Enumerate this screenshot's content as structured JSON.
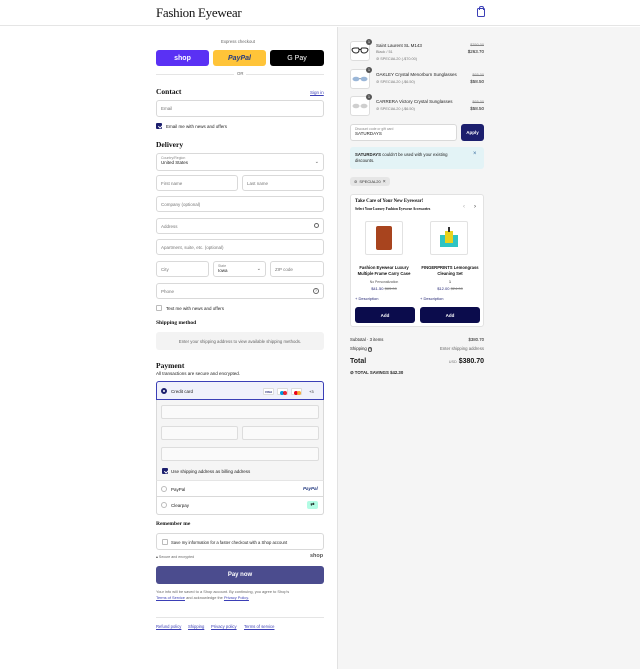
{
  "header": {
    "brand": "Fashion Eyewear",
    "cart_icon": "shopping-bag-icon"
  },
  "express": {
    "title": "Express checkout",
    "shop_label": "shop",
    "paypal_label": "PayPal",
    "gpay_label": "G Pay",
    "or_label": "OR",
    "colors": {
      "shop": "#5a31f4",
      "paypal": "#ffc439",
      "gpay": "#000000"
    }
  },
  "contact": {
    "heading": "Contact",
    "sign_in": "Sign in",
    "email_placeholder": "Email",
    "news_label": "Email me with news and offers",
    "news_checked": true
  },
  "delivery": {
    "heading": "Delivery",
    "country_label": "Country/Region",
    "country_value": "United States",
    "first_name": "First name",
    "last_name": "Last name",
    "company": "Company (optional)",
    "address": "Address",
    "apartment": "Apartment, suite, etc. (optional)",
    "city": "City",
    "state_label": "State",
    "state_value": "Iowa",
    "zip": "ZIP code",
    "phone": "Phone",
    "text_label": "Text me with news and offers"
  },
  "shipping_method": {
    "heading": "Shipping method",
    "notice": "Enter your shipping address to view available shipping methods."
  },
  "payment": {
    "heading": "Payment",
    "subtitle": "All transactions are secure and encrypted.",
    "credit_card": "Credit card",
    "card_brands": [
      "VISA",
      "",
      "",
      "+3"
    ],
    "billing_label": "Use shipping address as billing address",
    "paypal": "PayPal",
    "paypal_logo": "PayPal",
    "clearpay": "Clearpay",
    "clearpay_logo": "⇄"
  },
  "remember": {
    "heading": "Remember me",
    "save_label": "Save my information for a faster checkout with a Shop account",
    "secure": "Secure and encrypted",
    "shop_logo": "shop"
  },
  "pay_button": "Pay now",
  "legal": {
    "line1": "Your info will be saved to a Shop account. By continuing, you agree to Shop's",
    "tos": "Terms of Service",
    "and": "and acknowledge the",
    "privacy": "Privacy Policy."
  },
  "footer_links": [
    "Refund policy",
    "Shipping",
    "Privacy policy",
    "Terms of service"
  ],
  "cart": {
    "items": [
      {
        "qty": "1",
        "name": "Saint Laurent SL M143",
        "variant": "Black / 51",
        "discount": "SPECIAL20 (-$70.00)",
        "old": "$350.00",
        "price": "$263.70"
      },
      {
        "qty": "1",
        "name": "OAKLEY Crystal Menorburn Sunglasses",
        "variant": "",
        "discount": "SPECIAL20 (-$6.50)",
        "old": "$65.00",
        "price": "$58.50"
      },
      {
        "qty": "1",
        "name": "CARRERA Victory Crystal Sunglasses",
        "variant": "",
        "discount": "SPECIAL20 (-$6.50)",
        "old": "$65.00",
        "price": "$58.50"
      }
    ],
    "discount_label": "Discount code or gift card",
    "discount_value": "SATURDAYS",
    "apply": "Apply",
    "error_code": "SATURDAYS",
    "error_text": "couldn't be used with your existing discounts.",
    "applied_tag": "SPECIAL20",
    "upsell": {
      "title": "Take Care of Your New Eyewear!",
      "subtitle": "Select Your Luxury Fashion Eyewear Accessories",
      "products": [
        {
          "name": "Fashion Eyewear Luxury Multiple Frame Carry Case",
          "variant": "No Personalization",
          "price": "$41.50",
          "old": "$83.00",
          "desc": "Description",
          "add": "Add"
        },
        {
          "name": "FINGERPRINTS Lemongrass Cleaning Set",
          "variant": "1",
          "price": "$12.00",
          "old": "$24.00",
          "desc": "Description",
          "add": "Add"
        }
      ]
    },
    "subtotal_label": "Subtotal · 3 items",
    "subtotal": "$380.70",
    "shipping_label": "Shipping",
    "shipping_value": "Enter shipping address",
    "total_label": "Total",
    "currency": "USD",
    "total": "$380.70",
    "savings_label": "TOTAL SAVINGS",
    "savings": "$42.30"
  }
}
